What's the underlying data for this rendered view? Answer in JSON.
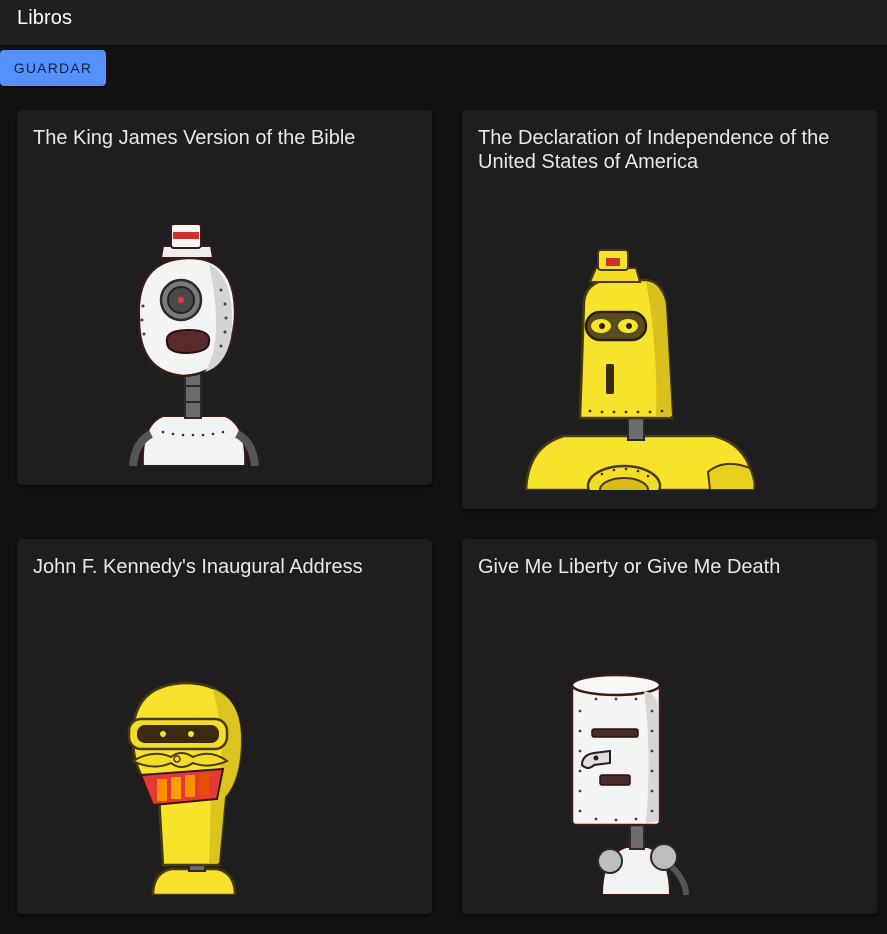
{
  "appbar": {
    "title": "Libros"
  },
  "toolbar": {
    "save_label": "GUARDAR"
  },
  "books": [
    {
      "title": "The King James Version of the Bible",
      "robot": "white-cyclops-robot"
    },
    {
      "title": "The Declaration of Independence of the United States of America",
      "robot": "yellow-visor-robot"
    },
    {
      "title": "John F. Kennedy's Inaugural Address",
      "robot": "yellow-goggle-robot"
    },
    {
      "title": "Give Me Liberty or Give Me Death",
      "robot": "white-box-robot"
    }
  ]
}
